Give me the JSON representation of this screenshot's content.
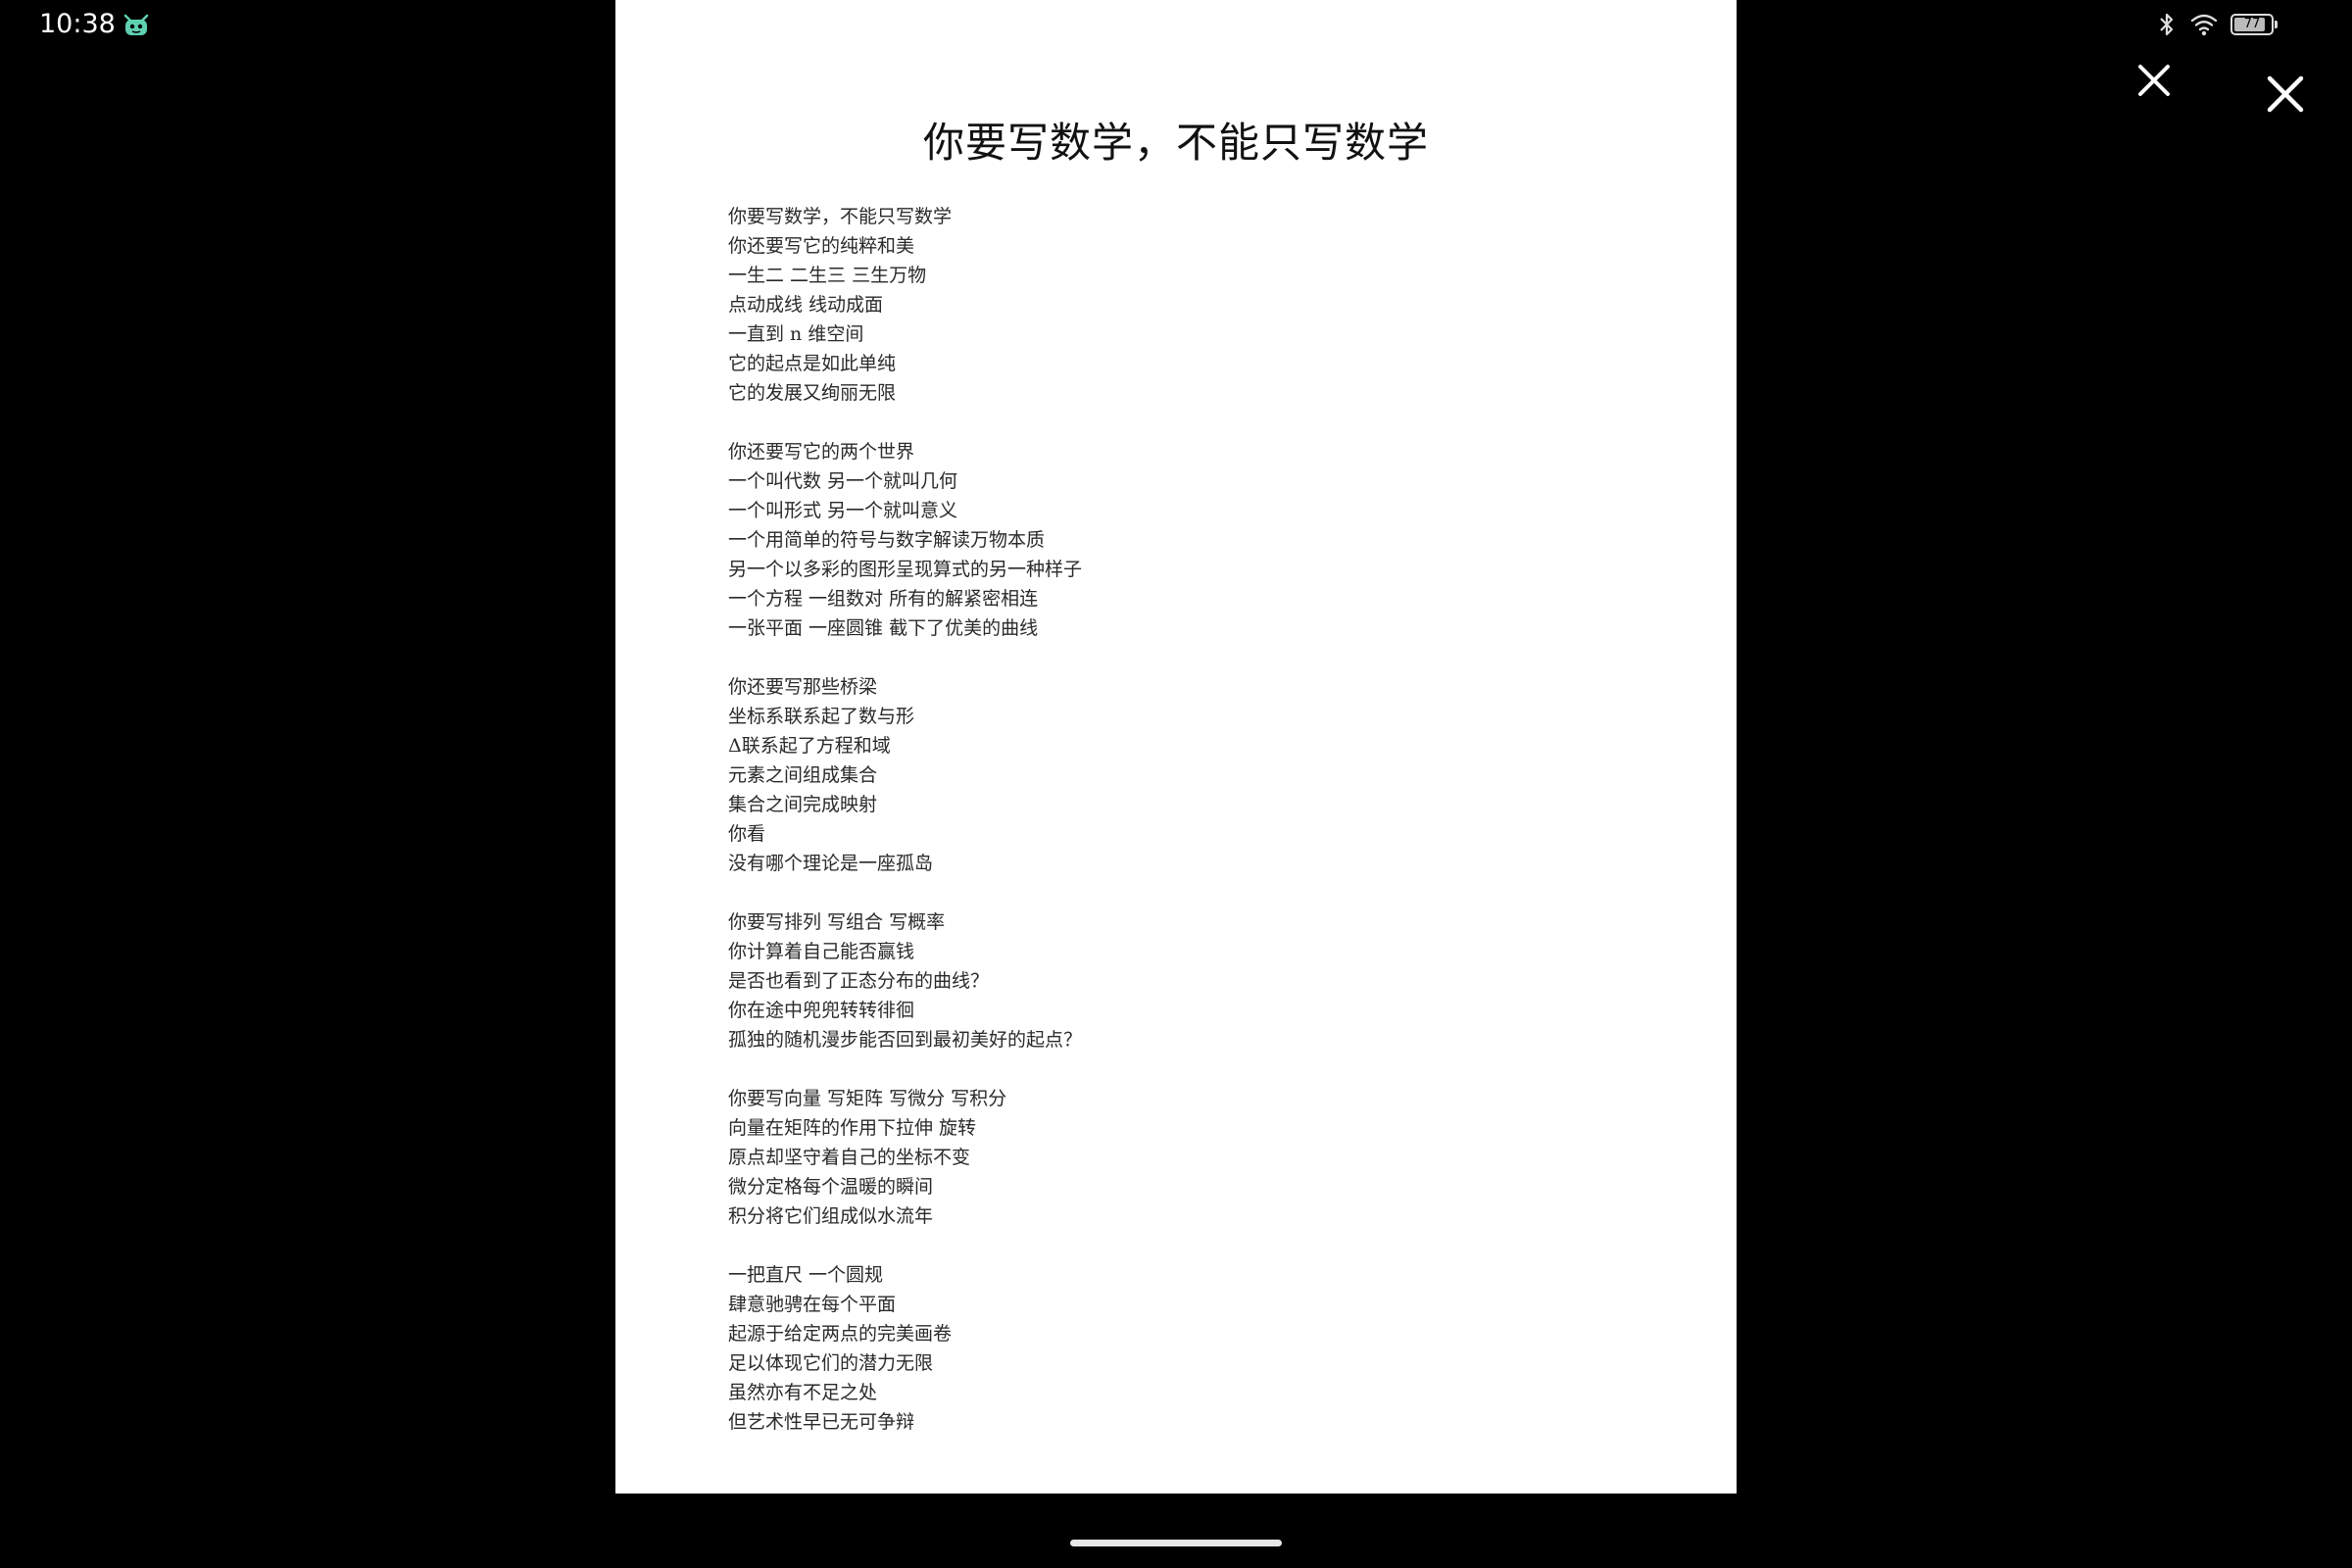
{
  "status_bar": {
    "time": "10:38",
    "battery_level": "77",
    "icons": [
      "app-notification-icon",
      "bluetooth-icon",
      "wifi-icon",
      "battery-icon"
    ]
  },
  "viewer": {
    "close_buttons": [
      "close-icon",
      "close-icon"
    ]
  },
  "document": {
    "title": "你要写数学，不能只写数学",
    "stanzas": [
      [
        "你要写数学，不能只写数学",
        "你还要写它的纯粹和美",
        "一生二 二生三 三生万物",
        "点动成线 线动成面",
        "一直到 n 维空间",
        "它的起点是如此单纯",
        "它的发展又绚丽无限"
      ],
      [
        "你还要写它的两个世界",
        "一个叫代数 另一个就叫几何",
        "一个叫形式 另一个就叫意义",
        "一个用简单的符号与数字解读万物本质",
        "另一个以多彩的图形呈现算式的另一种样子",
        "一个方程 一组数对 所有的解紧密相连",
        "一张平面 一座圆锥 截下了优美的曲线"
      ],
      [
        "你还要写那些桥梁",
        "坐标系联系起了数与形",
        "Δ联系起了方程和域",
        "元素之间组成集合",
        "集合之间完成映射",
        "你看",
        "没有哪个理论是一座孤岛"
      ],
      [
        "你要写排列 写组合 写概率",
        "你计算着自己能否赢钱",
        "是否也看到了正态分布的曲线？",
        "你在途中兜兜转转徘徊",
        "孤独的随机漫步能否回到最初美好的起点？"
      ],
      [
        "你要写向量 写矩阵 写微分 写积分",
        "向量在矩阵的作用下拉伸 旋转",
        "原点却坚守着自己的坐标不变",
        "微分定格每个温暖的瞬间",
        "积分将它们组成似水流年"
      ],
      [
        "一把直尺 一个圆规",
        "肆意驰骋在每个平面",
        "起源于给定两点的完美画卷",
        "足以体现它们的潜力无限",
        "虽然亦有不足之处",
        "但艺术性早已无可争辩"
      ]
    ]
  },
  "colors": {
    "background": "#000000",
    "page": "#ffffff",
    "text": "#222222",
    "status_text": "#ffffff"
  }
}
